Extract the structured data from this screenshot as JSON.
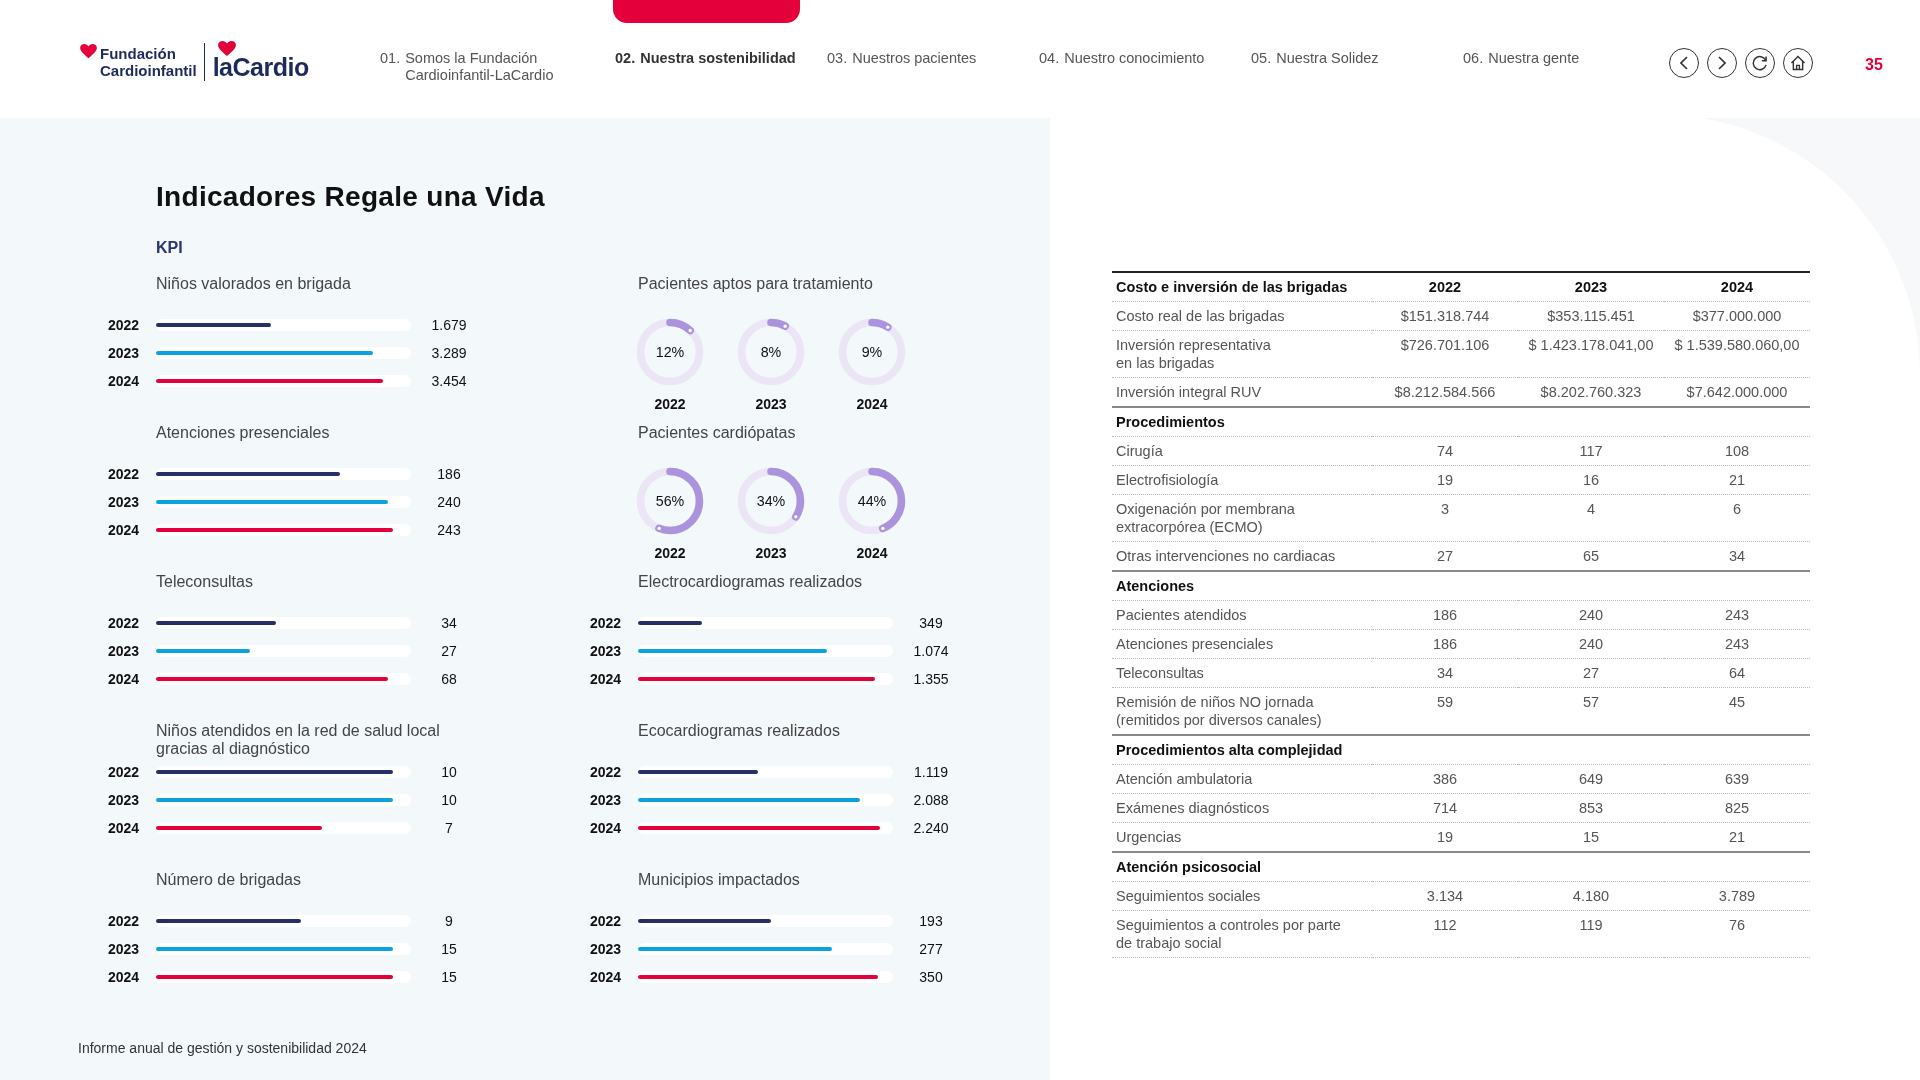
{
  "logo": {
    "line1": "Fundación",
    "line2": "Cardioinfantil",
    "brand": "laCardio"
  },
  "nav": [
    {
      "number": "01.",
      "label": "Somos la Fundación\nCardioinfantil-LaCardio",
      "selected": false
    },
    {
      "number": "02.",
      "label": "Nuestra sostenibilidad",
      "selected": true
    },
    {
      "number": "03.",
      "label": "Nuestros pacientes",
      "selected": false
    },
    {
      "number": "04.",
      "label": "Nuestro conocimiento",
      "selected": false
    },
    {
      "number": "05.",
      "label": "Nuestra Solidez",
      "selected": false
    },
    {
      "number": "06.",
      "label": "Nuestra gente",
      "selected": false
    }
  ],
  "page_number": "35",
  "title": "Indicadores Regale una Vida",
  "section_label": "KPI",
  "indicators": [
    {
      "kind": "bars",
      "title": "Niños valorados en brigada",
      "rows": [
        {
          "year": "2022",
          "level": 0.45,
          "value": "1.679",
          "color": "#263066"
        },
        {
          "year": "2023",
          "level": 0.85,
          "value": "3.289",
          "color": "#0aa3e0"
        },
        {
          "year": "2024",
          "level": 0.89,
          "value": "3.454",
          "color": "#e4003b"
        }
      ]
    },
    {
      "kind": "donuts",
      "title": "Pacientes aptos para tratamiento",
      "items": [
        {
          "percent": "12%",
          "level": 0.12,
          "year": "2022"
        },
        {
          "percent": "8%",
          "level": 0.08,
          "year": "2023"
        },
        {
          "percent": "9%",
          "level": 0.09,
          "year": "2024"
        }
      ]
    },
    {
      "kind": "bars",
      "title": "Atenciones presenciales",
      "rows": [
        {
          "year": "2022",
          "level": 0.72,
          "value": "186",
          "color": "#263066"
        },
        {
          "year": "2023",
          "level": 0.91,
          "value": "240",
          "color": "#0aa3e0"
        },
        {
          "year": "2024",
          "level": 0.93,
          "value": "243",
          "color": "#e4003b"
        }
      ]
    },
    {
      "kind": "donuts",
      "title": "Pacientes cardiópatas",
      "items": [
        {
          "percent": "56%",
          "level": 0.56,
          "year": "2022"
        },
        {
          "percent": "34%",
          "level": 0.34,
          "year": "2023"
        },
        {
          "percent": "44%",
          "level": 0.44,
          "year": "2024"
        }
      ]
    },
    {
      "kind": "bars",
      "title": "Teleconsultas",
      "rows": [
        {
          "year": "2022",
          "level": 0.47,
          "value": "34",
          "color": "#263066"
        },
        {
          "year": "2023",
          "level": 0.37,
          "value": "27",
          "color": "#0aa3e0"
        },
        {
          "year": "2024",
          "level": 0.91,
          "value": "68",
          "color": "#e4003b"
        }
      ]
    },
    {
      "kind": "bars",
      "title": "Electrocardiogramas realizados",
      "rows": [
        {
          "year": "2022",
          "level": 0.25,
          "value": "349",
          "color": "#263066"
        },
        {
          "year": "2023",
          "level": 0.74,
          "value": "1.074",
          "color": "#0aa3e0"
        },
        {
          "year": "2024",
          "level": 0.93,
          "value": "1.355",
          "color": "#e4003b"
        }
      ]
    },
    {
      "kind": "bars",
      "title": "Niños atendidos en la red de salud local gracias al diagnóstico",
      "rows": [
        {
          "year": "2022",
          "level": 0.93,
          "value": "10",
          "color": "#263066"
        },
        {
          "year": "2023",
          "level": 0.93,
          "value": "10",
          "color": "#0aa3e0"
        },
        {
          "year": "2024",
          "level": 0.65,
          "value": "7",
          "color": "#e4003b"
        }
      ]
    },
    {
      "kind": "bars",
      "title": "Ecocardiogramas realizados",
      "rows": [
        {
          "year": "2022",
          "level": 0.47,
          "value": "1.119",
          "color": "#263066"
        },
        {
          "year": "2023",
          "level": 0.87,
          "value": "2.088",
          "color": "#0aa3e0"
        },
        {
          "year": "2024",
          "level": 0.95,
          "value": "2.240",
          "color": "#e4003b"
        }
      ]
    },
    {
      "kind": "bars",
      "title": "Número de brigadas",
      "rows": [
        {
          "year": "2022",
          "level": 0.57,
          "value": "9",
          "color": "#263066"
        },
        {
          "year": "2023",
          "level": 0.93,
          "value": "15",
          "color": "#0aa3e0"
        },
        {
          "year": "2024",
          "level": 0.93,
          "value": "15",
          "color": "#e4003b"
        }
      ]
    },
    {
      "kind": "bars",
      "title": "Municipios impactados",
      "rows": [
        {
          "year": "2022",
          "level": 0.52,
          "value": "193",
          "color": "#263066"
        },
        {
          "year": "2023",
          "level": 0.76,
          "value": "277",
          "color": "#0aa3e0"
        },
        {
          "year": "2024",
          "level": 0.94,
          "value": "350",
          "color": "#e4003b"
        }
      ]
    }
  ],
  "table": {
    "header": {
      "label": "Costo e inversión de las brigadas",
      "columns": [
        "2022",
        "2023",
        "2024"
      ]
    },
    "rows": [
      {
        "kind": "data",
        "label": "Costo real de las brigadas",
        "values": [
          "$151.318.744",
          "$353.115.451",
          "$377.000.000"
        ]
      },
      {
        "kind": "data",
        "label": "Inversión representativa\nen las brigadas",
        "values": [
          "$726.701.106",
          "$ 1.423.178.041,00",
          "$ 1.539.580.060,00"
        ]
      },
      {
        "kind": "data",
        "label": "Inversión integral RUV",
        "values": [
          "$8.212.584.566",
          "$8.202.760.323",
          "$7.642.000.000"
        ]
      },
      {
        "kind": "section",
        "label": "Procedimientos"
      },
      {
        "kind": "data",
        "label": "Cirugía",
        "values": [
          "74",
          "117",
          "108"
        ]
      },
      {
        "kind": "data",
        "label": "Electrofisiología",
        "values": [
          "19",
          "16",
          "21"
        ]
      },
      {
        "kind": "data",
        "label": "Oxigenación por membrana\nextracorpórea (ECMO)",
        "values": [
          "3",
          "4",
          "6"
        ]
      },
      {
        "kind": "data",
        "label": "Otras intervenciones no cardiacas",
        "values": [
          "27",
          "65",
          "34"
        ]
      },
      {
        "kind": "section",
        "label": "Atenciones"
      },
      {
        "kind": "data",
        "label": "Pacientes atendidos",
        "values": [
          "186",
          "240",
          "243"
        ]
      },
      {
        "kind": "data",
        "label": "Atenciones presenciales",
        "values": [
          "186",
          "240",
          "243"
        ]
      },
      {
        "kind": "data",
        "label": "Teleconsultas",
        "values": [
          "34",
          "27",
          "64"
        ]
      },
      {
        "kind": "data",
        "label": "Remisión de niños NO jornada\n(remitidos por diversos canales)",
        "values": [
          "59",
          "57",
          "45"
        ]
      },
      {
        "kind": "section",
        "label": "Procedimientos alta complejidad"
      },
      {
        "kind": "data",
        "label": "Atención ambulatoria",
        "values": [
          "386",
          "649",
          "639"
        ]
      },
      {
        "kind": "data",
        "label": "Exámenes diagnósticos",
        "values": [
          "714",
          "853",
          "825"
        ]
      },
      {
        "kind": "data",
        "label": "Urgencias",
        "values": [
          "19",
          "15",
          "21"
        ]
      },
      {
        "kind": "section",
        "label": "Atención psicosocial"
      },
      {
        "kind": "data",
        "label": "Seguimientos sociales",
        "values": [
          "3.134",
          "4.180",
          "3.789"
        ]
      },
      {
        "kind": "data",
        "label": "Seguimientos a controles por parte\nde trabajo social",
        "values": [
          "112",
          "119",
          "76"
        ]
      }
    ]
  },
  "footer": "Informe anual de gestión y sostenibilidad 2024"
}
